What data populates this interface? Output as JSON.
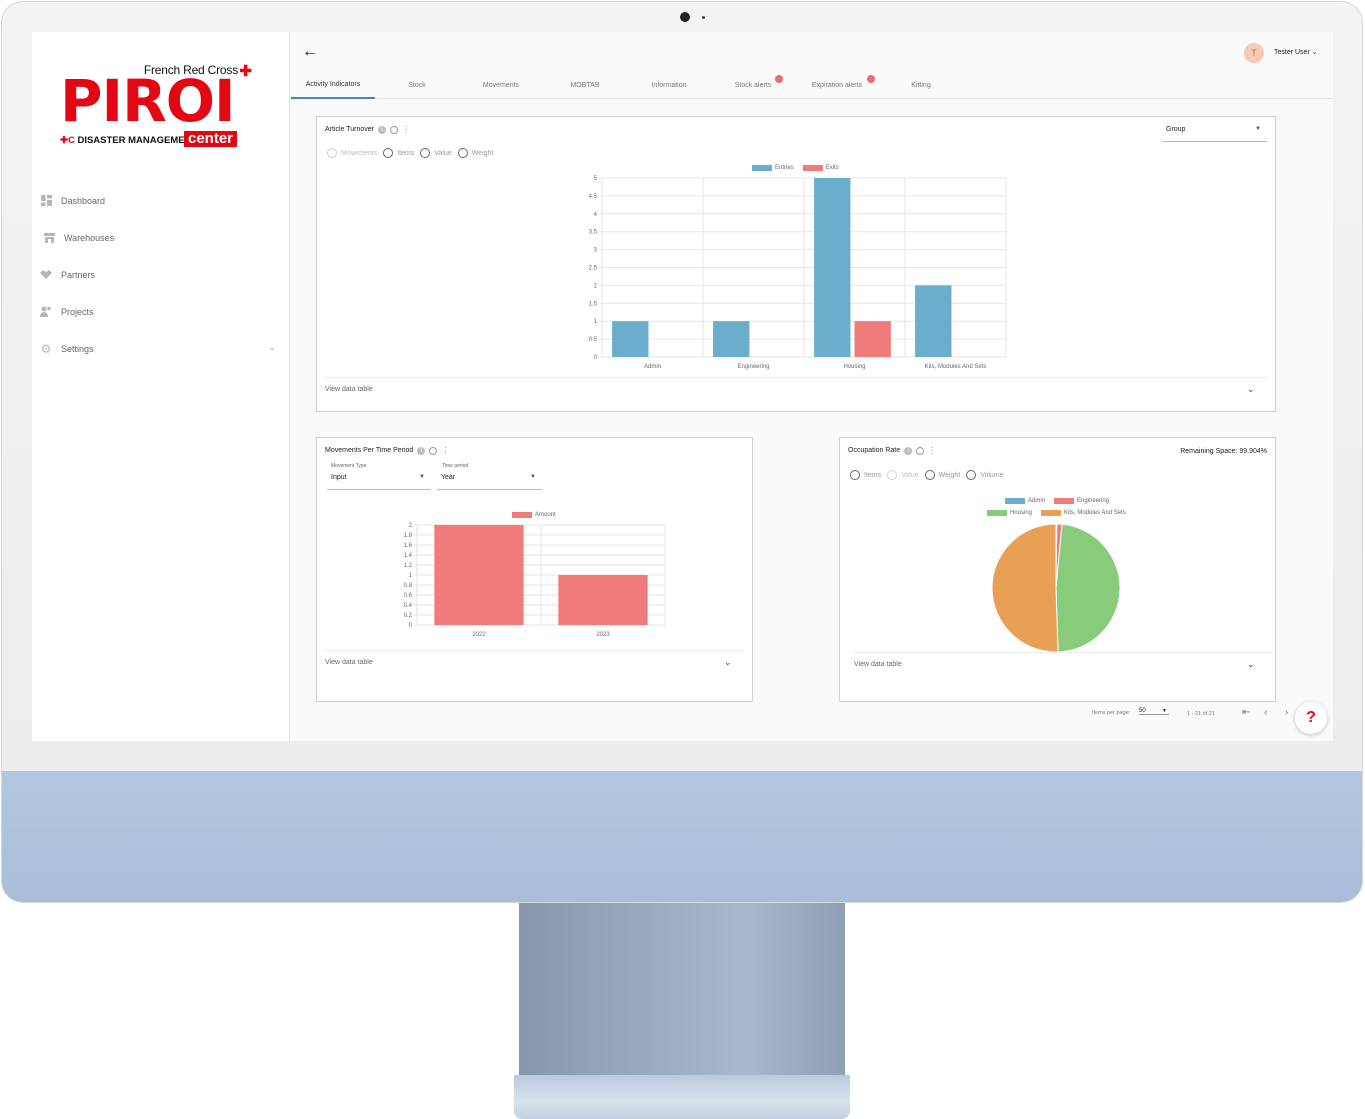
{
  "brand": {
    "french_red_cross": "French Red Cross",
    "piroi": "PIROI",
    "disaster": "DISASTER MANAGEMENT",
    "center": "center"
  },
  "sidebar": {
    "items": [
      {
        "label": "Dashboard",
        "icon": "dashboard-icon"
      },
      {
        "label": "Warehouses",
        "icon": "warehouse-icon"
      },
      {
        "label": "Partners",
        "icon": "handshake-icon"
      },
      {
        "label": "Projects",
        "icon": "people-icon"
      },
      {
        "label": "Settings",
        "icon": "gear-icon"
      }
    ]
  },
  "header": {
    "avatar_letter": "T",
    "user_name": "Tester User"
  },
  "tabs": [
    "Activity Indicators",
    "Stock",
    "Movements",
    "MOBTAB",
    "Information",
    "Stock alerts",
    "Expiration alerts",
    "Kitting"
  ],
  "article_turnover": {
    "title": "Article Turnover",
    "radios": [
      "Movements",
      "Items",
      "Value",
      "Weight"
    ],
    "group_select": "Group",
    "view_table": "View data table"
  },
  "movements_period": {
    "title": "Movements Per Time Period",
    "movement_type_label": "Movement Type",
    "movement_type_value": "Input",
    "time_period_label": "Time period",
    "time_period_value": "Year",
    "view_table": "View data table"
  },
  "occupation": {
    "title": "Occupation Rate",
    "remaining": "Remaining Space: 99.904%",
    "radios": [
      "Items",
      "Value",
      "Weight",
      "Volume"
    ],
    "view_table": "View data table"
  },
  "pager": {
    "items_per_page_label": "Items per page:",
    "items_per_page_value": "50",
    "range": "1 - 21 of 21"
  },
  "help_label": "?",
  "colors": {
    "entries": "#6aaecb",
    "exits": "#f07b7b",
    "amount": "#f07b7b",
    "admin": "#6aaecb",
    "engineering": "#f07b7b",
    "housing": "#88cb7a",
    "kits": "#e8a055",
    "brand_red": "#e30613"
  },
  "chart_data": [
    {
      "type": "bar",
      "categories": [
        "Admin",
        "Engineering",
        "Housing",
        "Kits, Modules And Sets"
      ],
      "series": [
        {
          "name": "Entries",
          "values": [
            1,
            1,
            5,
            2
          ]
        },
        {
          "name": "Exits",
          "values": [
            0,
            0,
            1,
            0
          ]
        }
      ],
      "ylim": [
        0,
        5
      ],
      "yticks": [
        "0",
        "0.5",
        "1",
        "1.5",
        "2",
        "2.5",
        "3",
        "3.5",
        "4",
        "4.5",
        "5"
      ],
      "legend": "top"
    },
    {
      "type": "bar",
      "categories": [
        "2022",
        "2023"
      ],
      "series": [
        {
          "name": "Amount",
          "values": [
            2,
            1
          ]
        }
      ],
      "ylim": [
        0,
        2
      ],
      "yticks": [
        "0",
        "0.2",
        "0.4",
        "0.6",
        "0.8",
        "1",
        "1.2",
        "1.4",
        "1.6",
        "1.8",
        "2"
      ],
      "legend": "top"
    },
    {
      "type": "pie",
      "categories": [
        "Admin",
        "Engineering",
        "Housing",
        "Kits, Modules And Sets"
      ],
      "values": [
        0.2,
        1.3,
        48.0,
        50.5
      ],
      "legend": "top"
    }
  ]
}
